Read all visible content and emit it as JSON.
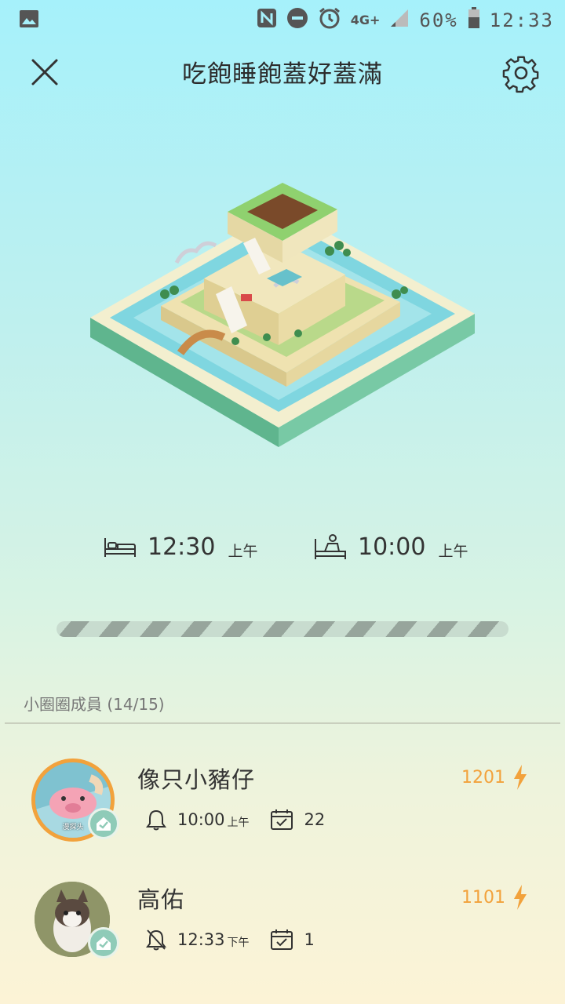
{
  "status_bar": {
    "battery": "60%",
    "time": "12:33",
    "network": "4G+"
  },
  "header": {
    "title": "吃飽睡飽蓋好蓋滿"
  },
  "schedule": {
    "bedtime": "12:30",
    "bedtime_period": "上午",
    "wake_time": "10:00",
    "wake_period": "上午"
  },
  "members_section": {
    "label": "小圈圈成員 (14/15)"
  },
  "members": [
    {
      "name": "像只小豬仔",
      "alarm_time": "10:00",
      "alarm_period": "上午",
      "days": "22",
      "score": "1201",
      "avatar_caption": "漫探头"
    },
    {
      "name": "高佑",
      "alarm_time": "12:33",
      "alarm_period": "下午",
      "days": "1",
      "score": "1101"
    }
  ],
  "colors": {
    "accent_orange": "#f2a23c",
    "badge_green": "#8fcbb8"
  }
}
